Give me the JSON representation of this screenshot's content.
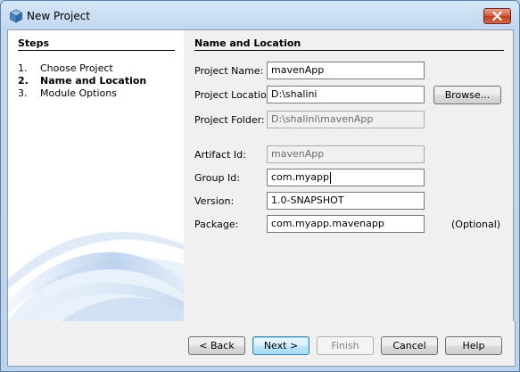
{
  "window": {
    "title": "New Project"
  },
  "steps": {
    "heading": "Steps",
    "items": [
      {
        "num": "1.",
        "label": "Choose Project"
      },
      {
        "num": "2.",
        "label": "Name and Location"
      },
      {
        "num": "3.",
        "label": "Module Options"
      }
    ],
    "current_index": 1
  },
  "form": {
    "heading": "Name and Location",
    "project_name": {
      "label": "Project Name:",
      "value": "mavenApp"
    },
    "project_location": {
      "label": "Project Location:",
      "value": "D:\\shalini"
    },
    "project_folder": {
      "label": "Project Folder:",
      "value": "D:\\shalini\\mavenApp"
    },
    "artifact_id": {
      "label": "Artifact Id:",
      "value": "mavenApp"
    },
    "group_id": {
      "label": "Group Id:",
      "value": "com.myapp"
    },
    "version": {
      "label": "Version:",
      "value": "1.0-SNAPSHOT"
    },
    "package": {
      "label": "Package:",
      "value": "com.myapp.mavenapp",
      "note": "(Optional)"
    },
    "browse_label": "Browse..."
  },
  "buttons": {
    "back": "< Back",
    "next": "Next >",
    "finish": "Finish",
    "cancel": "Cancel",
    "help": "Help"
  },
  "colors": {
    "title_bar": "#c3d8ef",
    "close_button": "#d4563a",
    "default_button_border": "#3c7fb1",
    "pane_background": "#f0f0f0"
  }
}
